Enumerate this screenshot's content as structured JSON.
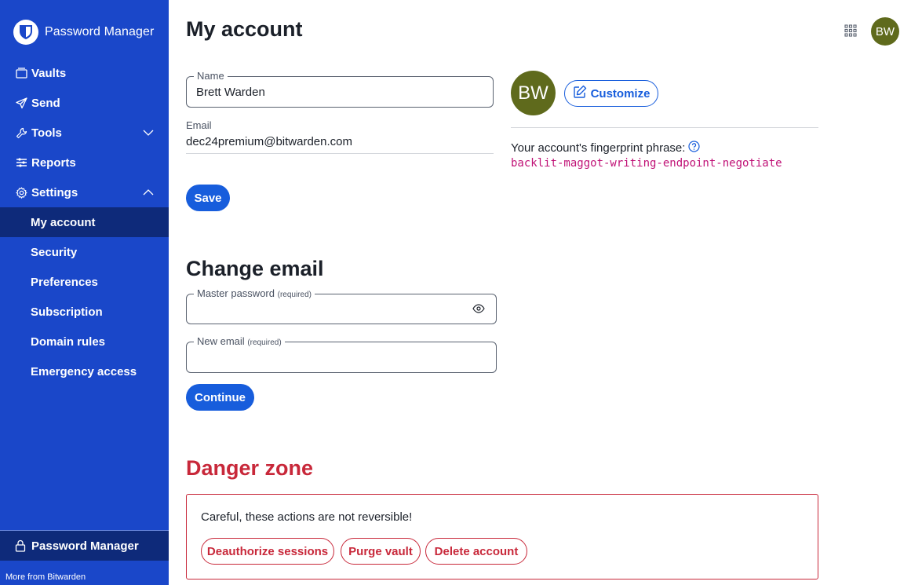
{
  "brand": {
    "name": "Password Manager"
  },
  "nav": {
    "vaults": "Vaults",
    "send": "Send",
    "tools": "Tools",
    "reports": "Reports",
    "settings": "Settings",
    "sub": {
      "my_account": "My account",
      "security": "Security",
      "preferences": "Preferences",
      "subscription": "Subscription",
      "domain_rules": "Domain rules",
      "emergency_access": "Emergency access"
    }
  },
  "footer": {
    "product": "Password Manager",
    "more": "More from Bitwarden"
  },
  "header": {
    "title": "My account",
    "avatar_initials": "BW"
  },
  "profile": {
    "name_label": "Name",
    "name_value": "Brett Warden",
    "email_label": "Email",
    "email_value": "dec24premium@bitwarden.com",
    "save_label": "Save",
    "avatar_initials": "BW",
    "customize_label": "Customize",
    "fingerprint_label": "Your account's fingerprint phrase:",
    "fingerprint_phrase": "backlit-maggot-writing-endpoint-negotiate"
  },
  "change_email": {
    "title": "Change email",
    "master_password_label": "Master password",
    "new_email_label": "New email",
    "required_label": "(required)",
    "continue_label": "Continue"
  },
  "danger": {
    "title": "Danger zone",
    "warning": "Careful, these actions are not reversible!",
    "deauthorize_label": "Deauthorize sessions",
    "purge_label": "Purge vault",
    "delete_label": "Delete account"
  },
  "colors": {
    "sidebar": "#1a47c9",
    "sidebar_active": "#0e2a7a",
    "primary": "#175ddc",
    "danger": "#c8283a",
    "avatar": "#5f6a1c",
    "fingerprint": "#c01176"
  }
}
